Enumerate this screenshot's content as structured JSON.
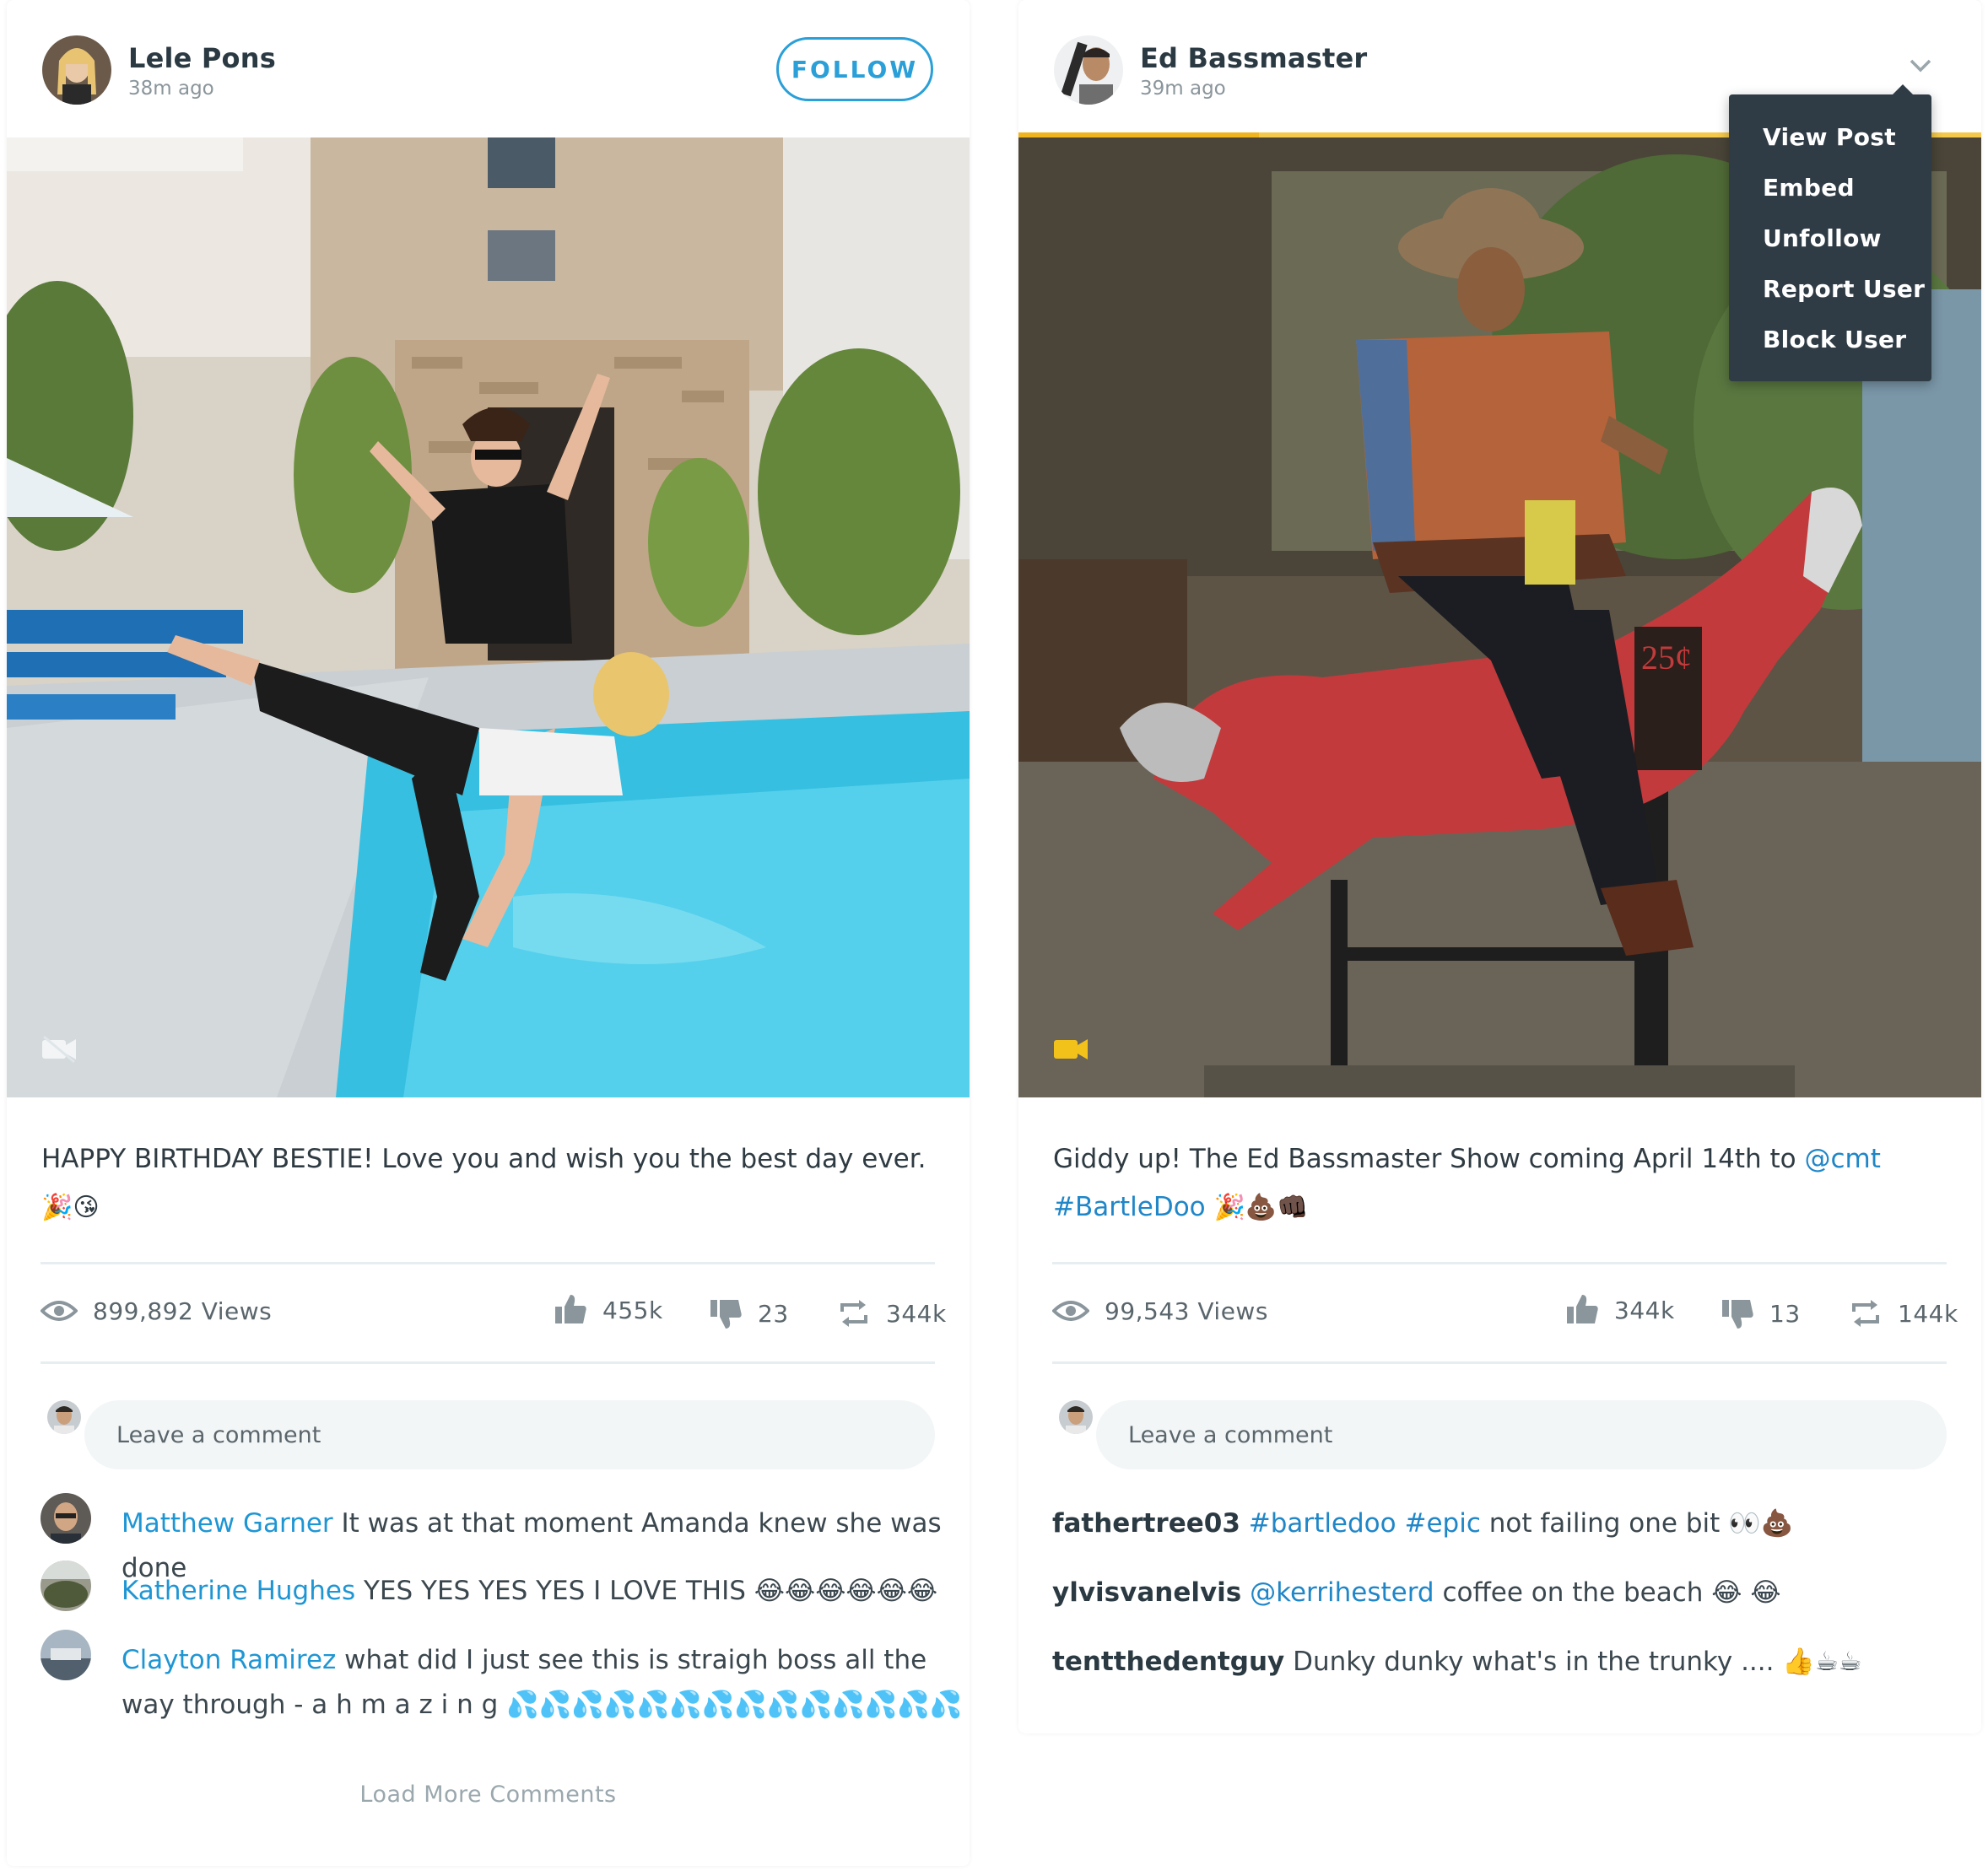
{
  "posts": [
    {
      "author": "Lele Pons",
      "time": "38m ago",
      "follow_label": "FOLLOW",
      "caption_text": "HAPPY BIRTHDAY BESTIE! Love you and wish you the best day ever.",
      "caption_emoji": "🎉😘",
      "views": "899,892 Views",
      "likes": "455k",
      "dislikes": "23",
      "reposts": "344k",
      "comment_placeholder": "Leave a comment",
      "comments": [
        {
          "user": "Matthew Garner",
          "text": "It was at that moment Amanda knew she was done"
        },
        {
          "user": "Katherine Hughes",
          "text": "YES YES YES YES I LOVE THIS 😂😂😂😂😂😂"
        },
        {
          "user": "Clayton Ramirez",
          "text": "what did I just see this is straigh boss all the way through - a h m a z i n g 💦💦💦💦💦💦💦💦💦💦💦💦💦💦"
        }
      ],
      "load_more": "Load More Comments"
    },
    {
      "author": "Ed Bassmaster",
      "time": "39m ago",
      "caption_text": "Giddy up! The Ed Bassmaster Show coming April 14th to",
      "caption_mention": "@cmt",
      "caption_hashtag": "#BartleDoo",
      "caption_emoji": "🎉💩👊🏿",
      "video_progress": 0.25,
      "views": "99,543 Views",
      "likes": "344k",
      "dislikes": "13",
      "reposts": "144k",
      "comment_placeholder": "Leave a comment",
      "comments": [
        {
          "user": "fathertree03",
          "tag1": "#bartledoo",
          "tag2": "#epic",
          "text": "not failing one bit 👀💩"
        },
        {
          "user": "ylvisvanelvis",
          "tag1": "@kerrihesterd",
          "text": "coffee on the beach 😂 😂"
        },
        {
          "user": "tentthedentguy",
          "text": "Dunky dunky what's in the trunky .... 👍☕☕"
        }
      ]
    }
  ],
  "menu": {
    "items": [
      "View Post",
      "Embed",
      "Unfollow",
      "Report User",
      "Block User"
    ]
  },
  "colors": {
    "accent": "#2a9fd8",
    "link": "#1f86c8",
    "progress": "#f0b41f",
    "menu_bg": "#2f3b45"
  }
}
